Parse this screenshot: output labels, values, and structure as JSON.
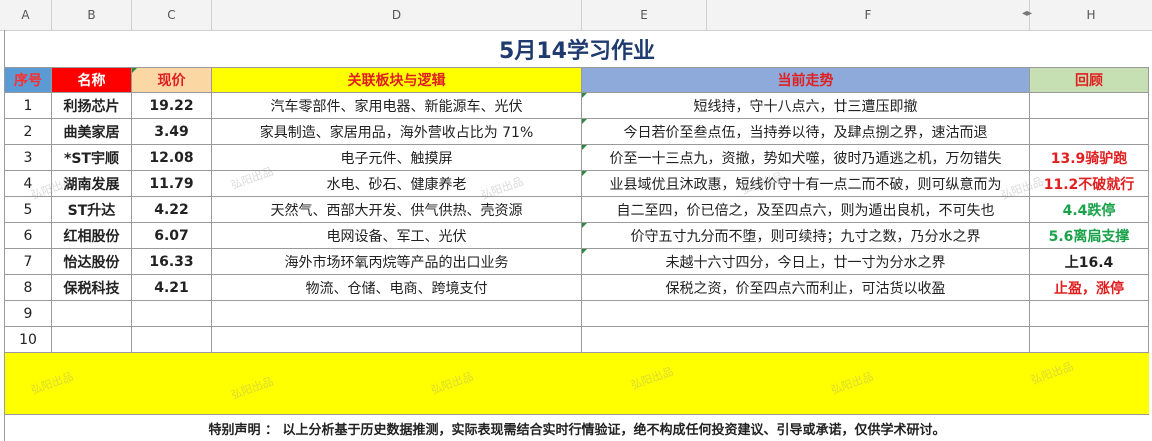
{
  "columns": [
    "A",
    "B",
    "C",
    "D",
    "E",
    "F",
    "H"
  ],
  "title": "5月14学习作业",
  "headers": {
    "seq": "序号",
    "name": "名称",
    "price": "现价",
    "sector": "关联板块与逻辑",
    "trend": "当前走势",
    "review": "回顾"
  },
  "rows": [
    {
      "seq": "1",
      "name": "利扬芯片",
      "price": "19.22",
      "sector": "汽车零部件、家用电器、新能源车、光伏",
      "trend": "短线持，守十八点六，廿三遭压即撤",
      "review": ""
    },
    {
      "seq": "2",
      "name": "曲美家居",
      "price": "3.49",
      "sector": "家具制造、家居用品，海外营收占比为 71%",
      "trend": "今日若价至叁点伍，当持券以待，及肆点捌之界，速沽而退",
      "review": ""
    },
    {
      "seq": "3",
      "name": "*ST宇顺",
      "price": "12.08",
      "sector": "电子元件、触摸屏",
      "trend": "价至一十三点九，资撤，势如犬噬，彼时乃遁逃之机，万勿错失",
      "review": "13.9骑驴跑"
    },
    {
      "seq": "4",
      "name": "湖南发展",
      "price": "11.79",
      "sector": "水电、砂石、健康养老",
      "trend": "业县域优且沐政惠，短线价守十有一点二而不破，则可纵意而为",
      "review": "11.2不破就行"
    },
    {
      "seq": "5",
      "name": "ST升达",
      "price": "4.22",
      "sector": "天然气、西部大开发、供气供热、壳资源",
      "trend": "自二至四，价已倍之，及至四点六，则为遁出良机，不可失也",
      "review": "4.4跌停"
    },
    {
      "seq": "6",
      "name": "红相股份",
      "price": "6.07",
      "sector": "电网设备、军工、光伏",
      "trend": "价守五寸九分而不堕，则可续持；九寸之数，乃分水之界",
      "review": "5.6离扃支撑"
    },
    {
      "seq": "7",
      "name": "怡达股份",
      "price": "16.33",
      "sector": "海外市场环氧丙烷等产品的出口业务",
      "trend": "未越十六寸四分，今日上，廿一寸为分水之界",
      "review": "上16.4"
    },
    {
      "seq": "8",
      "name": "保税科技",
      "price": "4.21",
      "sector": "物流、仓储、电商、跨境支付",
      "trend": "保税之资，价至四点六而利止，可沽货以收盈",
      "review": "止盈，涨停"
    },
    {
      "seq": "9",
      "name": "",
      "price": "",
      "sector": "",
      "trend": "",
      "review": ""
    },
    {
      "seq": "10",
      "name": "",
      "price": "",
      "sector": "",
      "trend": "",
      "review": ""
    }
  ],
  "review_colors": [
    "",
    "",
    "#e02020",
    "#e02020",
    "#1aa24a",
    "#1aa24a",
    "#222222",
    "#e02020",
    "",
    ""
  ],
  "watermark": "弘阳出品",
  "footer": "特别声明 ：  以上分析基于历史数据推测，实际表现需结合实时行情验证，绝不构成任何投资建议、引导或承诺，仅供学术研讨。"
}
